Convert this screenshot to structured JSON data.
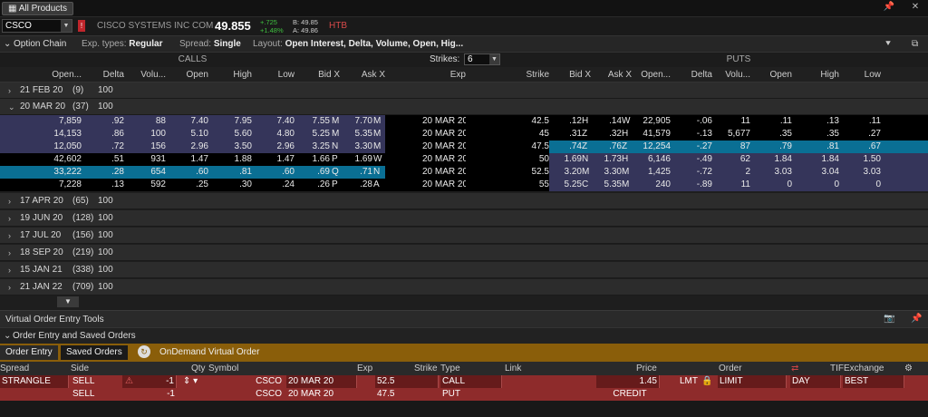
{
  "topbar": {
    "all_products": "All Products"
  },
  "quote": {
    "symbol": "CSCO",
    "company": "CISCO SYSTEMS INC COM",
    "last": "49.855",
    "change": "+.725",
    "change_pct": "+1.48%",
    "bid": "B: 49.85",
    "ask": "A: 49.86",
    "htb": "HTB"
  },
  "option_chain": {
    "title": "Option Chain",
    "exp_types_label": "Exp. types:",
    "exp_types_value": "Regular",
    "spread_label": "Spread:",
    "spread_value": "Single",
    "layout_label": "Layout:",
    "layout_value": "Open Interest, Delta, Volume, Open, Hig..."
  },
  "chain_header": {
    "calls": "CALLS",
    "puts": "PUTS",
    "strikes_label": "Strikes:",
    "strikes_value": "6"
  },
  "call_columns": [
    "Open...",
    "Delta",
    "Volu...",
    "Open",
    "High",
    "Low",
    "Bid X",
    "Ask X"
  ],
  "mid_columns": [
    "Exp",
    "Strike"
  ],
  "put_columns": [
    "Bid X",
    "Ask X",
    "Open...",
    "Delta",
    "Volu...",
    "Open",
    "High",
    "Low"
  ],
  "expirations_before": [
    {
      "name": "21 FEB 20",
      "count": "(9)",
      "mult": "100",
      "expanded": false
    }
  ],
  "expanded": {
    "name": "20 MAR 20",
    "count": "(37)",
    "mult": "100"
  },
  "rows": [
    {
      "c": [
        "7,859",
        ".92",
        "88",
        "7.40",
        "7.95",
        "7.40",
        "7.55",
        "M",
        "7.70",
        "M"
      ],
      "exp": "20 MAR 20",
      "strike": "42.5",
      "p": [
        ".12",
        "H",
        ".14",
        "W",
        "22,905",
        "-.06",
        "11",
        ".11",
        ".13",
        ".11"
      ],
      "style": "itm"
    },
    {
      "c": [
        "14,153",
        ".86",
        "100",
        "5.10",
        "5.60",
        "4.80",
        "5.25",
        "M",
        "5.35",
        "M"
      ],
      "exp": "20 MAR 20",
      "strike": "45",
      "p": [
        ".31",
        "Z",
        ".32",
        "H",
        "41,579",
        "-.13",
        "5,677",
        ".35",
        ".35",
        ".27"
      ],
      "style": "itm"
    },
    {
      "c": [
        "12,050",
        ".72",
        "156",
        "2.96",
        "3.50",
        "2.96",
        "3.25",
        "N",
        "3.30",
        "M"
      ],
      "exp": "20 MAR 20",
      "strike": "47.5",
      "p": [
        ".74",
        "Z",
        ".76",
        "Z",
        "12,254",
        "-.27",
        "87",
        ".79",
        ".81",
        ".67"
      ],
      "style": "itm",
      "put_sel": true
    },
    {
      "c": [
        "42,602",
        ".51",
        "931",
        "1.47",
        "1.88",
        "1.47",
        "1.66",
        "P",
        "1.69",
        "W"
      ],
      "exp": "20 MAR 20",
      "strike": "50",
      "p": [
        "1.69",
        "N",
        "1.73",
        "H",
        "6,146",
        "-.49",
        "62",
        "1.84",
        "1.84",
        "1.50"
      ],
      "style": "otm"
    },
    {
      "c": [
        "33,222",
        ".28",
        "654",
        ".60",
        ".81",
        ".60",
        ".69",
        "Q",
        ".71",
        "N"
      ],
      "exp": "20 MAR 20",
      "strike": "52.5",
      "p": [
        "3.20",
        "M",
        "3.30",
        "M",
        "1,425",
        "-.72",
        "2",
        "3.03",
        "3.04",
        "3.03"
      ],
      "style": "otm",
      "call_sel": true
    },
    {
      "c": [
        "7,228",
        ".13",
        "592",
        ".25",
        ".30",
        ".24",
        ".26",
        "P",
        ".28",
        "A"
      ],
      "exp": "20 MAR 20",
      "strike": "55",
      "p": [
        "5.25",
        "C",
        "5.35",
        "M",
        "240",
        "-.89",
        "11",
        "0",
        "0",
        "0"
      ],
      "style": "otm"
    }
  ],
  "expirations_after": [
    {
      "name": "17 APR 20",
      "count": "(65)",
      "mult": "100"
    },
    {
      "name": "19 JUN 20",
      "count": "(128)",
      "mult": "100"
    },
    {
      "name": "17 JUL 20",
      "count": "(156)",
      "mult": "100"
    },
    {
      "name": "18 SEP 20",
      "count": "(219)",
      "mult": "100"
    },
    {
      "name": "15 JAN 21",
      "count": "(338)",
      "mult": "100"
    },
    {
      "name": "21 JAN 22",
      "count": "(709)",
      "mult": "100"
    }
  ],
  "voe": {
    "title": "Virtual Order Entry Tools",
    "section": "Order Entry and Saved Orders",
    "tab_entry": "Order Entry",
    "tab_saved": "Saved Orders",
    "ondemand": "OnDemand Virtual Order"
  },
  "order_columns": {
    "spread": "Spread",
    "side": "Side",
    "qty": "Qty",
    "symbol": "Symbol",
    "exp": "Exp",
    "strike": "Strike",
    "type": "Type",
    "link": "Link",
    "price": "Price",
    "order": "Order",
    "tif": "TIF",
    "exchange": "Exchange"
  },
  "orders": [
    {
      "spread": "STRANGLE",
      "side": "SELL",
      "qty": "-1",
      "symbol": "CSCO",
      "exp": "20 MAR 20",
      "strike": "52.5",
      "type": "CALL",
      "price": "1.45",
      "price_type": "LMT",
      "order": "LIMIT",
      "tif": "DAY",
      "exchange": "BEST"
    },
    {
      "spread": "",
      "side": "SELL",
      "qty": "-1",
      "symbol": "CSCO",
      "exp": "20 MAR 20",
      "strike": "47.5",
      "type": "PUT",
      "price": "CREDIT",
      "price_type": "",
      "order": "",
      "tif": "",
      "exchange": ""
    }
  ],
  "colors": {
    "itm": "#35355a",
    "otm": "#000000",
    "selected": "#0a6f94",
    "order_row": "#8e2b2b",
    "tab_bar": "#8a5e0a"
  }
}
